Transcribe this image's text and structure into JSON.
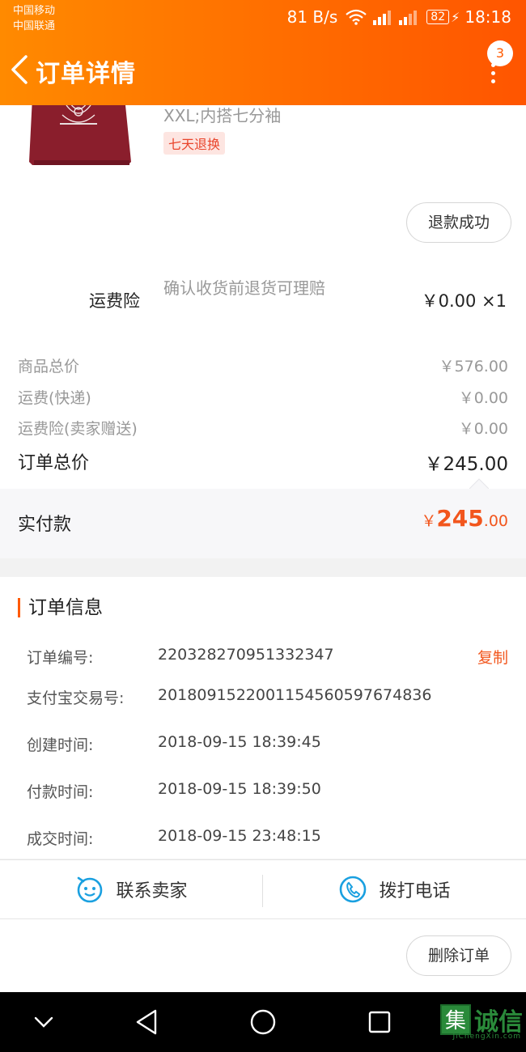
{
  "status_bar": {
    "carrier_1": "中国移动",
    "carrier_2": "中国联通",
    "speed": "81 B/s",
    "battery": "82",
    "time": "18:18"
  },
  "header": {
    "title": "订单详情",
    "badge": "3"
  },
  "product": {
    "sku": "XXL;内搭七分袖",
    "tag": "七天退换",
    "refund_status": "退款成功"
  },
  "insurance": {
    "label": "运费险",
    "desc": "确认收货前退货可理赔",
    "price": "￥0.00 ×1"
  },
  "totals": {
    "goods_label": "商品总价",
    "goods_value": "￥576.00",
    "shipping_label": "运费(快递)",
    "shipping_value": "￥0.00",
    "ins_label": "运费险(卖家赠送)",
    "ins_value": "￥0.00",
    "order_label": "订单总价",
    "order_value": "￥245.00"
  },
  "paid": {
    "label": "实付款",
    "currency": "￥",
    "int": "245",
    "dec": ".00"
  },
  "order_info": {
    "title": "订单信息",
    "rows": [
      {
        "key": "订单编号:",
        "value": "220328270951332347"
      },
      {
        "key": "支付宝交易号:",
        "value": "2018091522001154560597674836"
      },
      {
        "key": "创建时间:",
        "value": "2018-09-15 18:39:45"
      },
      {
        "key": "付款时间:",
        "value": "2018-09-15 18:39:50"
      },
      {
        "key": "成交时间:",
        "value": "2018-09-15 23:48:15"
      }
    ],
    "copy_label": "复制"
  },
  "actions": {
    "contact": "联系卖家",
    "call": "拨打电话",
    "delete": "删除订单"
  },
  "watermark": {
    "char": "集",
    "text": "诚信",
    "sub": "JiChengXin.com"
  },
  "colors": {
    "accent": "#ff6a00",
    "price": "#f2561d",
    "icon_blue": "#1aa0e0"
  }
}
